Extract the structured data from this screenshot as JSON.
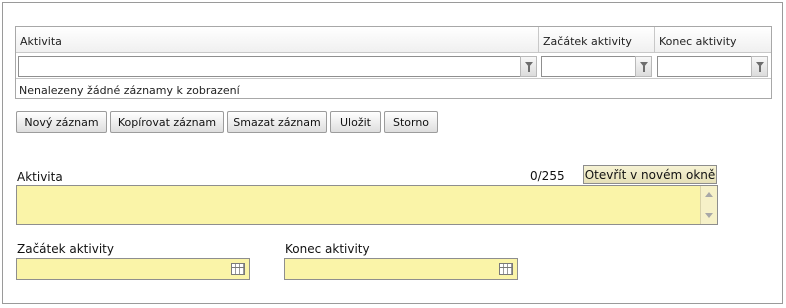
{
  "grid": {
    "columns": [
      "Aktivita",
      "Začátek aktivity",
      "Konec aktivity"
    ],
    "filters": [
      "",
      "",
      ""
    ],
    "empty_message": "Nenalezeny žádné záznamy k zobrazení"
  },
  "buttons": {
    "new": "Nový záznam",
    "copy": "Kopírovat záznam",
    "delete": "Smazat záznam",
    "save": "Uložit",
    "cancel": "Storno"
  },
  "form": {
    "activity_label": "Aktivita",
    "activity_value": "",
    "counter": "0/255",
    "open_window": "Otevřít v novém okně",
    "start_label": "Začátek aktivity",
    "start_value": "",
    "end_label": "Konec aktivity",
    "end_value": ""
  },
  "colors": {
    "required_field": "#faf4a8",
    "border": "#8e8e8e"
  },
  "icons": {
    "filter": "filter-icon",
    "calendar": "calendar-icon",
    "scroll_up": "scroll-up-icon",
    "scroll_down": "scroll-down-icon"
  }
}
